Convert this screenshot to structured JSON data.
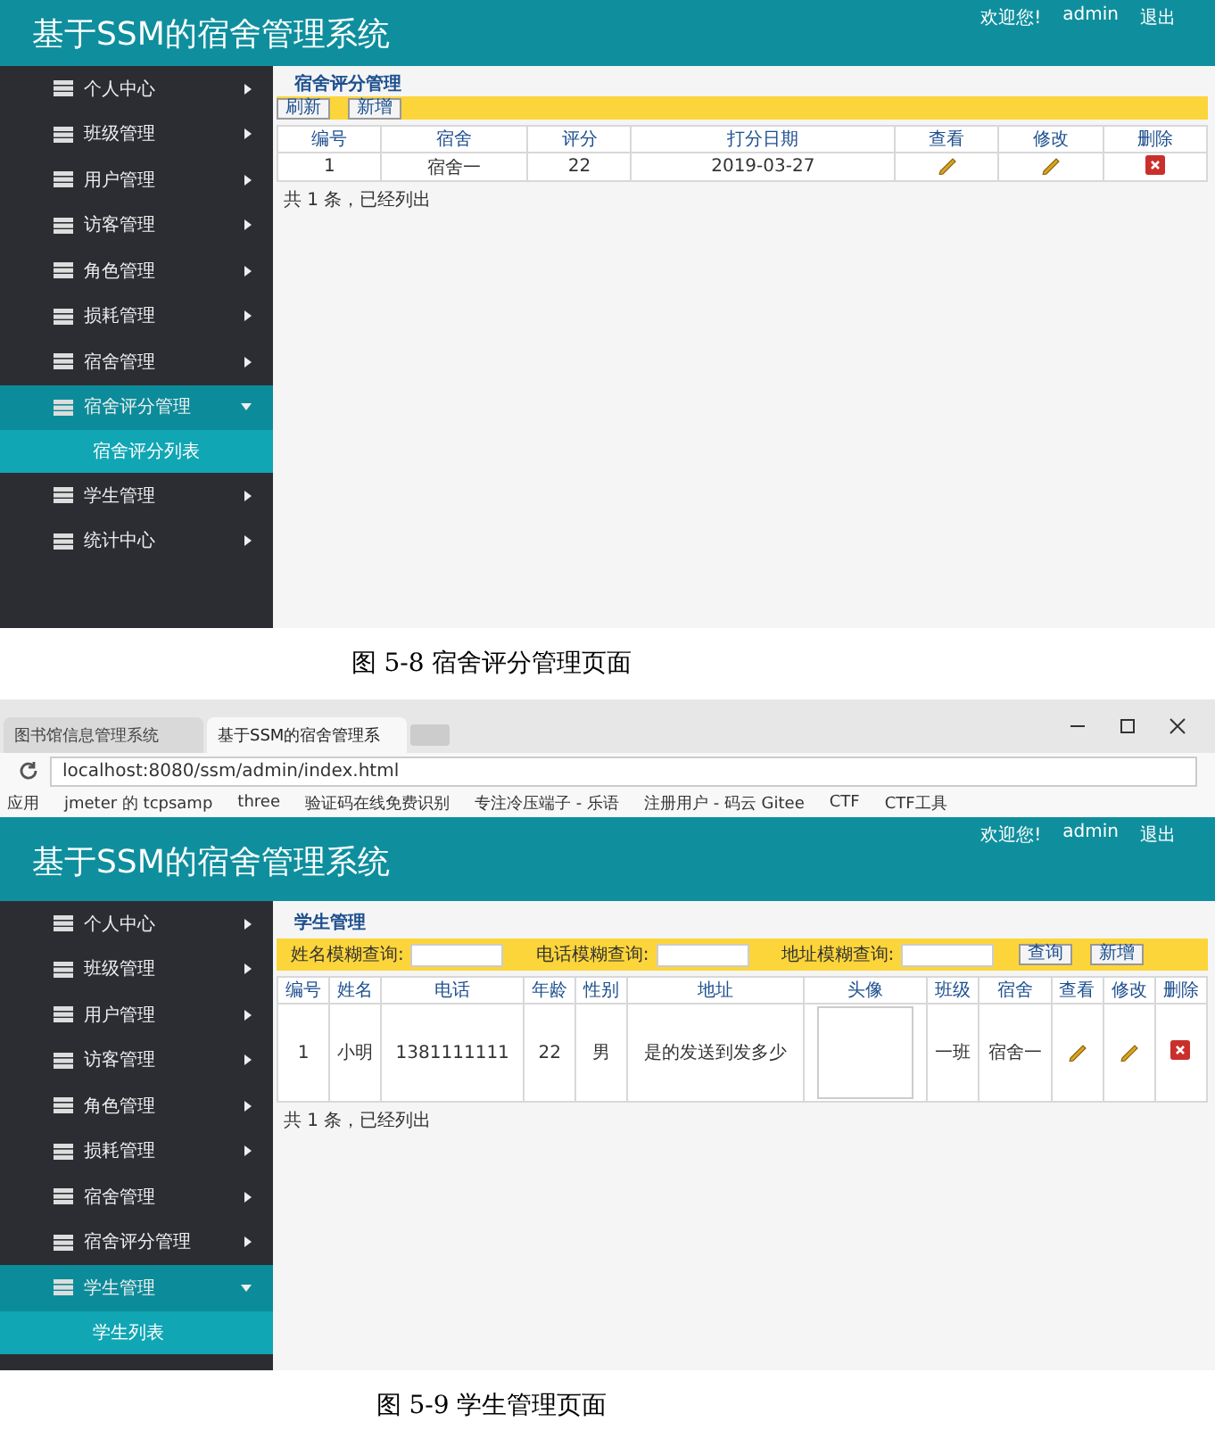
{
  "figures": [
    {
      "app": {
        "title": "基于SSM的宿舍管理系统",
        "user_links": [
          "欢迎您!",
          "admin",
          "退出"
        ],
        "sidebar": [
          {
            "label": "个人中心",
            "expanded": false
          },
          {
            "label": "班级管理",
            "expanded": false
          },
          {
            "label": "用户管理",
            "expanded": false
          },
          {
            "label": "访客管理",
            "expanded": false
          },
          {
            "label": "角色管理",
            "expanded": false
          },
          {
            "label": "损耗管理",
            "expanded": false
          },
          {
            "label": "宿舍管理",
            "expanded": false
          },
          {
            "label": "宿舍评分管理",
            "expanded": true,
            "children": [
              {
                "label": "宿舍评分列表"
              }
            ]
          },
          {
            "label": "学生管理",
            "expanded": false
          },
          {
            "label": "统计中心",
            "expanded": false
          }
        ],
        "panel": {
          "title": "宿舍评分管理",
          "toolbar": [
            {
              "kind": "button",
              "label": "刷新"
            },
            {
              "kind": "button",
              "label": "新增"
            }
          ],
          "columns": [
            {
              "label": "编号",
              "kind": "text"
            },
            {
              "label": "宿舍",
              "kind": "text"
            },
            {
              "label": "评分",
              "kind": "text"
            },
            {
              "label": "打分日期",
              "kind": "text"
            },
            {
              "label": "查看",
              "kind": "edit"
            },
            {
              "label": "修改",
              "kind": "edit"
            },
            {
              "label": "删除",
              "kind": "delete"
            }
          ],
          "rows": [
            {
              "cells": [
                "1",
                "宿舍一",
                "22",
                "2019-03-27",
                null,
                null,
                null
              ]
            }
          ],
          "footer": "共 1 条，已经列出"
        }
      },
      "caption": "图 5-8 宿舍评分管理页面"
    },
    {
      "browser": {
        "tabs": [
          {
            "label": "图书馆信息管理系统",
            "selected": false
          },
          {
            "label": "基于SSM的宿舍管理系",
            "selected": true
          }
        ],
        "url": "localhost:8080/ssm/admin/index.html",
        "bookmarks": [
          "应用",
          "jmeter 的 tcpsamp",
          "three",
          "验证码在线免费识别",
          "专注冷压端子 - 乐语",
          "注册用户 - 码云 Gitee",
          "CTF",
          "CTF工具"
        ]
      },
      "app": {
        "title": "基于SSM的宿舍管理系统",
        "user_links": [
          "欢迎您!",
          "admin",
          "退出"
        ],
        "sidebar": [
          {
            "label": "个人中心",
            "expanded": false
          },
          {
            "label": "班级管理",
            "expanded": false
          },
          {
            "label": "用户管理",
            "expanded": false
          },
          {
            "label": "访客管理",
            "expanded": false
          },
          {
            "label": "角色管理",
            "expanded": false
          },
          {
            "label": "损耗管理",
            "expanded": false
          },
          {
            "label": "宿舍管理",
            "expanded": false
          },
          {
            "label": "宿舍评分管理",
            "expanded": false
          },
          {
            "label": "学生管理",
            "expanded": true,
            "children": [
              {
                "label": "学生列表"
              }
            ]
          }
        ],
        "panel": {
          "title": "学生管理",
          "toolbar": [
            {
              "kind": "field",
              "label": "姓名模糊查询:"
            },
            {
              "kind": "field",
              "label": "电话模糊查询:"
            },
            {
              "kind": "field",
              "label": "地址模糊查询:"
            },
            {
              "kind": "button",
              "label": "查询"
            },
            {
              "kind": "button",
              "label": "新增"
            }
          ],
          "columns": [
            {
              "label": "编号",
              "kind": "text"
            },
            {
              "label": "姓名",
              "kind": "text"
            },
            {
              "label": "电话",
              "kind": "text"
            },
            {
              "label": "年龄",
              "kind": "text"
            },
            {
              "label": "性别",
              "kind": "text"
            },
            {
              "label": "地址",
              "kind": "text"
            },
            {
              "label": "头像",
              "kind": "image"
            },
            {
              "label": "班级",
              "kind": "text"
            },
            {
              "label": "宿舍",
              "kind": "text"
            },
            {
              "label": "查看",
              "kind": "edit"
            },
            {
              "label": "修改",
              "kind": "edit"
            },
            {
              "label": "删除",
              "kind": "delete"
            }
          ],
          "rows": [
            {
              "cells": [
                "1",
                "小明",
                "1381111111",
                "22",
                "男",
                "是的发送到发多少",
                null,
                "一班",
                "宿舍一",
                null,
                null,
                null
              ]
            }
          ],
          "footer": "共 1 条，已经列出"
        }
      },
      "caption": "图 5-9 学生管理页面"
    }
  ]
}
